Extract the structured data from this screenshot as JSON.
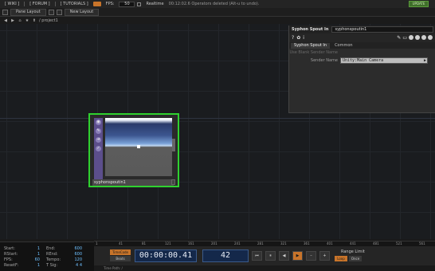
{
  "topbar": {
    "wiki": "[ WIKI ]",
    "forum": "[ FORUM ]",
    "tutorials": "[ TUTORIALS ]",
    "fps_label": "FPS:",
    "fps_value": "50",
    "realtime": "Realtime",
    "status": "00:12:02.6 Operators deleted (Alt-u to undo).",
    "update": "UPDATE"
  },
  "tabbar": {
    "pane_layout": "Pane Layout",
    "new_layout": "New Layout"
  },
  "path": {
    "text": "/ project1"
  },
  "params": {
    "op_type": "Syphon Spout In",
    "op_name": "syphonspoutin1",
    "tabs": [
      "Syphon Spout In",
      "Common"
    ],
    "row1_label": "Use Blank Sender Name",
    "sender_label": "Sender Name",
    "sender_value": "Unity:Main Camera"
  },
  "node": {
    "label": "syphonspoutin1"
  },
  "info": {
    "col1": [
      {
        "k": "Start:",
        "v": "1"
      },
      {
        "k": "RStart:",
        "v": "1"
      },
      {
        "k": "FPS:",
        "v": "60"
      },
      {
        "k": "ResetF:",
        "v": "1"
      }
    ],
    "col2": [
      {
        "k": "End:",
        "v": "600"
      },
      {
        "k": "REnd:",
        "v": "600"
      },
      {
        "k": "Tempo:",
        "v": "120"
      },
      {
        "k": "T Sig:",
        "v": "4   4"
      }
    ]
  },
  "ruler": [
    "1",
    "41",
    "81",
    "121",
    "161",
    "201",
    "241",
    "281",
    "321",
    "361",
    "401",
    "441",
    "481",
    "521",
    "561"
  ],
  "transport": {
    "timecode_btn": "TimeCode",
    "beats_btn": "Beats",
    "timecode": "00:00:00.41",
    "frame": "42",
    "buttons": [
      "⏮",
      "⏸",
      "◀",
      "▶",
      "–",
      "+"
    ],
    "range_label": "Range Limit",
    "loop": "Loop",
    "once": "Once"
  },
  "time_path": "Time Path: /"
}
